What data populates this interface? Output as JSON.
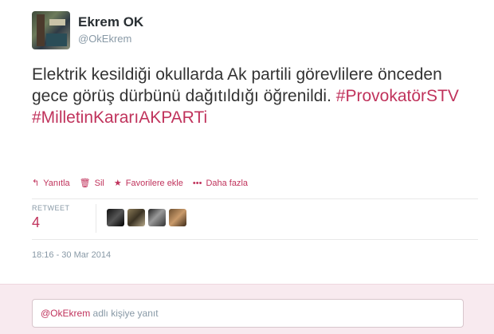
{
  "user": {
    "full_name": "Ekrem OK",
    "screen_name": "@OkEkrem"
  },
  "tweet": {
    "text_plain": "Elektrik kesildiği okullarda Ak partili görevlilere önceden gece görüş dürbünü dağıtıldığı öğrenildi.",
    "hashtags": [
      "#ProvokatörSTV",
      "#MilletinKararıAKPARTi"
    ]
  },
  "actions": {
    "reply": "Yanıtla",
    "delete": "Sil",
    "favorite": "Favorilere ekle",
    "more": "Daha fazla"
  },
  "icons": {
    "reply": "reply-arrow-icon",
    "delete": "trash-icon",
    "favorite": "star-icon",
    "more": "ellipsis-icon"
  },
  "retweets": {
    "label": "RETWEET",
    "count": "4"
  },
  "timestamp": "18:16 - 30 Mar 2014",
  "reply_box": {
    "handle": "@OkEkrem",
    "placeholder_rest": "adlı kişiye yanıt"
  },
  "colors": {
    "accent": "#c0335c",
    "reply_bg": "#f8eaef"
  }
}
